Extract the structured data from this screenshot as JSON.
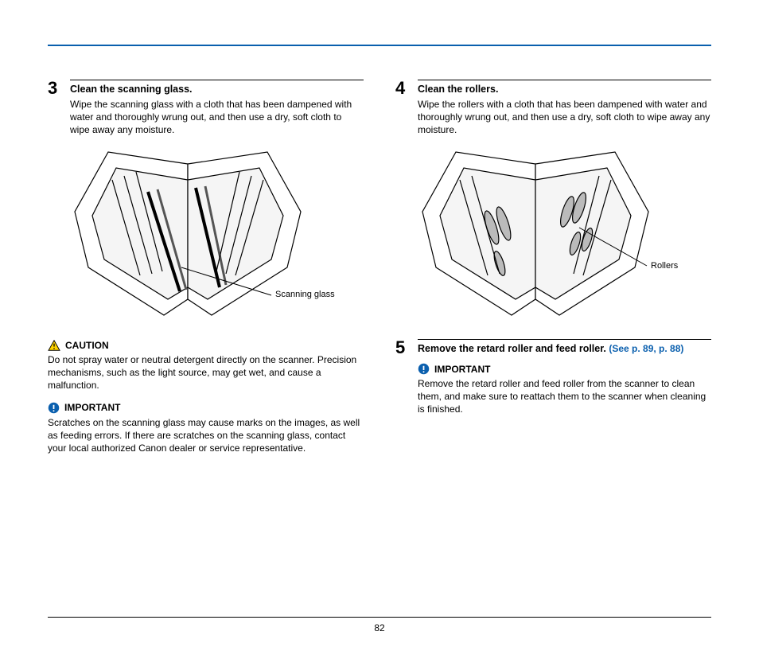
{
  "page_number": "82",
  "left": {
    "step3": {
      "num": "3",
      "title": "Clean the scanning glass.",
      "desc": "Wipe the scanning glass with a cloth that has been dampened with water and thoroughly wrung out, and then use a dry, soft cloth to wipe away any moisture.",
      "callout": "Scanning glass"
    },
    "caution": {
      "label": "CAUTION",
      "text": "Do not spray water or neutral detergent directly on the scanner. Precision mechanisms, such as the light source, may get wet, and cause a malfunction."
    },
    "important": {
      "label": "IMPORTANT",
      "text": "Scratches on the scanning glass may cause marks on the images, as well as feeding errors. If there are scratches on the scanning glass, contact your local authorized Canon dealer or service representative."
    }
  },
  "right": {
    "step4": {
      "num": "4",
      "title": "Clean the rollers.",
      "desc": "Wipe the rollers with a cloth that has been dampened with water and thoroughly wrung out, and then use a dry, soft cloth to wipe away any moisture.",
      "callout": "Rollers"
    },
    "step5": {
      "num": "5",
      "title": "Remove the retard roller and feed roller. ",
      "link": "(See p. 89, p. 88)"
    },
    "important": {
      "label": "IMPORTANT",
      "text": "Remove the retard roller and feed roller from the scanner to clean them, and make sure to reattach them to the scanner when cleaning is finished."
    }
  }
}
